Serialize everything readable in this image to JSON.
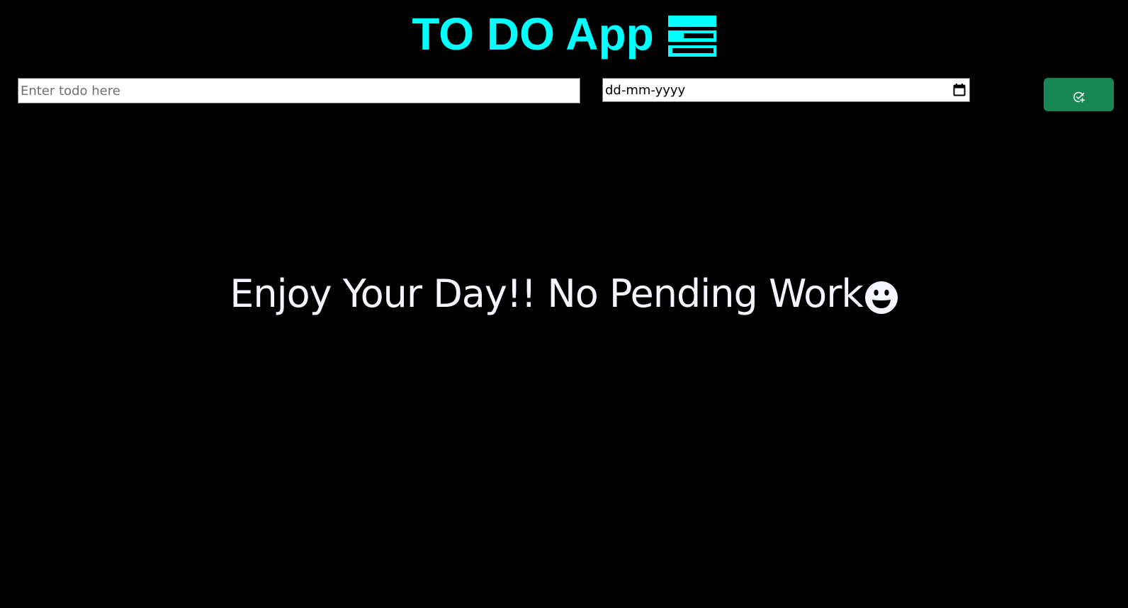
{
  "header": {
    "title": "TO DO App",
    "icon": "list-icon",
    "title_color": "#00ffff"
  },
  "form": {
    "todo_placeholder": "Enter todo here",
    "todo_value": "",
    "date_value": "dd-mm-yyyy",
    "date_icon": "calendar-icon",
    "add_button_icon": "check-circle-plus-icon",
    "add_button_color": "#198754"
  },
  "empty_state": {
    "message": "Enjoy Your Day!! No Pending Work",
    "icon": "smile-icon"
  },
  "colors": {
    "background": "#000000",
    "message_text": "#f5f5ff"
  }
}
